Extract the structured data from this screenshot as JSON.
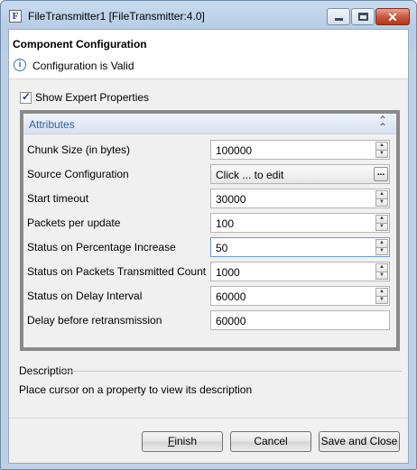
{
  "window": {
    "title": "FileTransmitter1 [FileTransmitter:4.0]",
    "app_icon_letter": "F"
  },
  "header": {
    "title": "Component Configuration",
    "status": "Configuration is Valid"
  },
  "expert": {
    "label": "Show Expert Properties",
    "checked": true
  },
  "attributes": {
    "title": "Attributes",
    "rows": [
      {
        "label": "Chunk Size (in bytes)",
        "value": "100000",
        "control": "spinner"
      },
      {
        "label": "Source Configuration",
        "value": "Click ... to edit",
        "control": "ellipsis"
      },
      {
        "label": "Start timeout",
        "value": "30000",
        "control": "spinner"
      },
      {
        "label": "Packets per update",
        "value": "100",
        "control": "spinner"
      },
      {
        "label": "Status on Percentage Increase",
        "value": "50",
        "control": "spinner"
      },
      {
        "label": "Status on Packets Transmitted Count",
        "value": "1000",
        "control": "spinner"
      },
      {
        "label": "Status on Delay Interval",
        "value": "60000",
        "control": "spinner"
      },
      {
        "label": "Delay before retransmission",
        "value": "60000",
        "control": "text"
      }
    ]
  },
  "description": {
    "title": "Description",
    "text": "Place cursor on a property to view its description"
  },
  "buttons": {
    "finish_first": "F",
    "finish_rest": "inish",
    "cancel": "Cancel",
    "save_close": "Save and Close",
    "ellipsis": "..."
  },
  "colors": {
    "accent": "#2f62a8",
    "window_frame": "#b6cde6",
    "close_button": "#c75a3e"
  }
}
